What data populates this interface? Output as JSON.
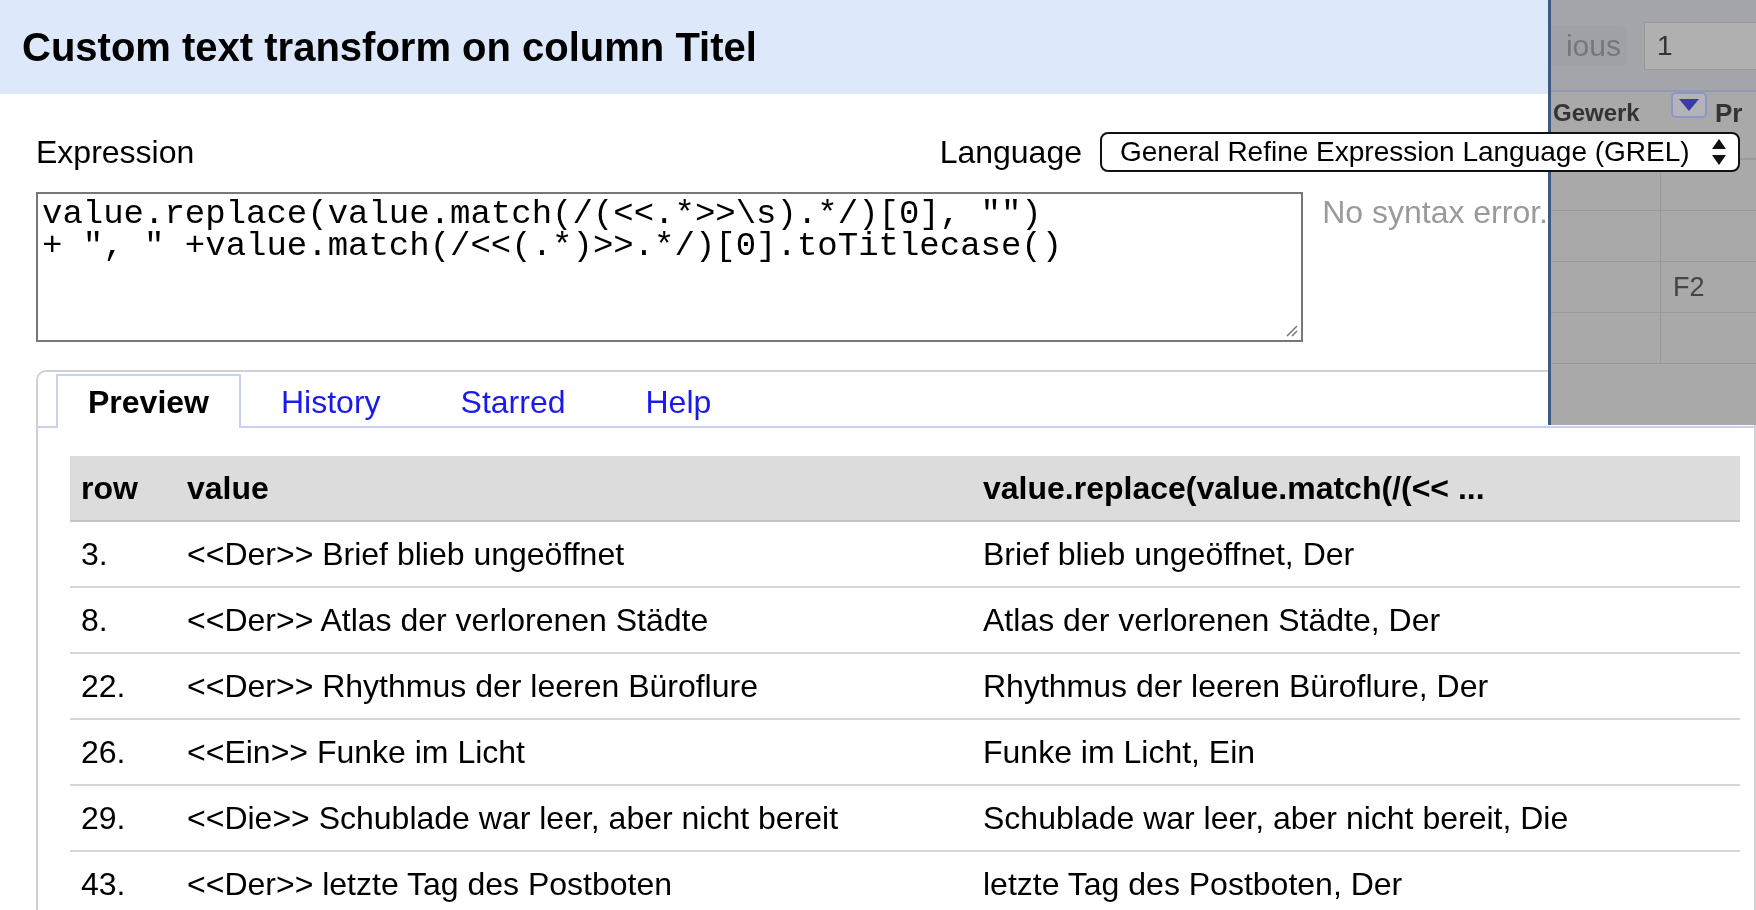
{
  "dialog": {
    "title": "Custom text transform on column Titel"
  },
  "expression": {
    "label": "Expression",
    "value": "value.replace(value.match(/(<<.*>>\\s).*/)[0], \"\")\n+ \", \" +value.match(/<<(.*)>>.*/)[0].toTitlecase()",
    "status": "No syntax error."
  },
  "language": {
    "label": "Language",
    "value": "General Refine Expression Language (GREL)"
  },
  "tabs": [
    {
      "label": "Preview",
      "selected": true
    },
    {
      "label": "History",
      "selected": false
    },
    {
      "label": "Starred",
      "selected": false
    },
    {
      "label": "Help",
      "selected": false
    }
  ],
  "preview": {
    "columns": [
      "row",
      "value",
      "value.replace(value.match(/(<< ..."
    ],
    "rows": [
      [
        "3.",
        "<<Der>> Brief blieb ungeöffnet",
        "Brief blieb ungeöffnet, Der"
      ],
      [
        "8.",
        "<<Der>> Atlas der verlorenen Städte",
        "Atlas der verlorenen Städte, Der"
      ],
      [
        "22.",
        "<<Der>> Rhythmus der leeren Büroflure",
        "Rhythmus der leeren Büroflure, Der"
      ],
      [
        "26.",
        "<<Ein>> Funke im Licht",
        "Funke im Licht, Ein"
      ],
      [
        "29.",
        "<<Die>> Schublade war leer, aber nicht bereit",
        "Schublade war leer, aber nicht bereit, Die"
      ],
      [
        "43.",
        "<<Der>> letzte Tag des Postboten",
        "letzte Tag des Postboten, Der"
      ]
    ]
  },
  "background": {
    "previous_button": "ious",
    "page_field": "1",
    "columns": [
      "Gewerk",
      "Pr"
    ],
    "cell": "F2"
  }
}
